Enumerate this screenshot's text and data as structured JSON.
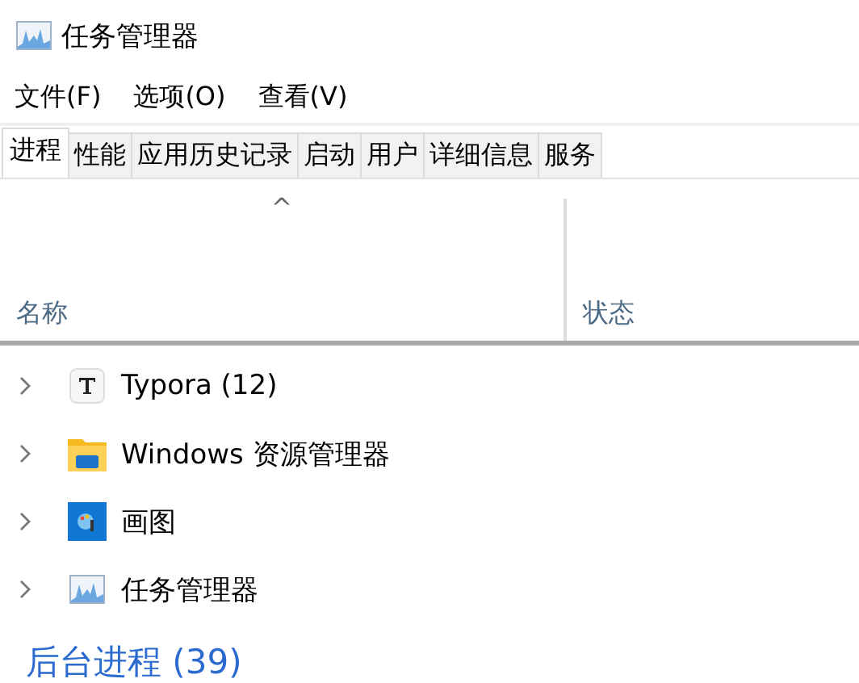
{
  "window": {
    "title": "任务管理器"
  },
  "menu": [
    "文件(F)",
    "选项(O)",
    "查看(V)"
  ],
  "tabs": [
    {
      "label": "进程",
      "selected": true
    },
    {
      "label": "性能",
      "selected": false
    },
    {
      "label": "应用历史记录",
      "selected": false
    },
    {
      "label": "启动",
      "selected": false
    },
    {
      "label": "用户",
      "selected": false
    },
    {
      "label": "详细信息",
      "selected": false
    },
    {
      "label": "服务",
      "selected": false
    }
  ],
  "table": {
    "sort_indicator": "^",
    "columns": [
      "名称",
      "状态"
    ],
    "rows": [
      {
        "name": "Typora (12)",
        "expanded": false
      },
      {
        "name": "Windows 资源管理器",
        "expanded": false
      },
      {
        "name": "画图",
        "expanded": false
      },
      {
        "name": "任务管理器",
        "expanded": false
      }
    ],
    "group": {
      "title": "后台进程 (39)"
    }
  }
}
